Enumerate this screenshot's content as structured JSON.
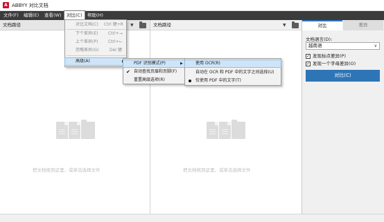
{
  "window": {
    "title": "ABBYY 对比文档",
    "icon_letter": "A"
  },
  "menubar": {
    "items": [
      {
        "label": "文件(F)"
      },
      {
        "label": "编辑(E)"
      },
      {
        "label": "查看(W)"
      },
      {
        "label": "对比(C)"
      },
      {
        "label": "帮助(H)"
      }
    ]
  },
  "left_panel": {
    "header": "文档路径",
    "drop_hint": "把文档拖到这里，或单击选择文件"
  },
  "right_panel": {
    "header": "文档路径",
    "drop_hint": "把文档拖到这里，或单击选择文件"
  },
  "sidebar": {
    "tabs": [
      {
        "label": "对比"
      },
      {
        "label": "差异"
      }
    ],
    "language_label": "文档语言(D):",
    "language_value": "越南语",
    "options": [
      {
        "label": "发现标点差异(P)",
        "checked": true
      },
      {
        "label": "发现一个字母差异(O)",
        "checked": true
      }
    ],
    "compare_button": "对比(C)"
  },
  "compare_menu": {
    "items": [
      {
        "label": "对比文档(C)",
        "shortcut": "Ctrl 键+R",
        "disabled": true
      },
      {
        "label": "下个差异(E)",
        "shortcut": "Ctrl+→",
        "disabled": true
      },
      {
        "label": "上个差异(P)",
        "shortcut": "Ctrl+←",
        "disabled": true
      },
      {
        "label": "忽略差异(G)",
        "shortcut": "Del 键",
        "disabled": true
      },
      {
        "label": "高级(A)",
        "submenu": true,
        "highlighted": true
      }
    ]
  },
  "advanced_menu": {
    "items": [
      {
        "label": "PDF 识别模式(P)",
        "submenu": true,
        "highlighted": true
      },
      {
        "label": "自动查找页眉和页脚(F)",
        "checked": true
      },
      {
        "label": "重置高级选项(R)"
      }
    ]
  },
  "pdf_mode_menu": {
    "items": [
      {
        "label": "使用 OCR(R)",
        "highlighted": true
      },
      {
        "label": "自动在 OCR 和 PDF 中的文字之间选择(U)"
      },
      {
        "label": "仅使用 PDF 中的文字(T)",
        "selected": true
      }
    ]
  },
  "colors": {
    "accent": "#2e75b6",
    "menubar": "#3b3b3b",
    "highlight": "#cfe4f6"
  }
}
